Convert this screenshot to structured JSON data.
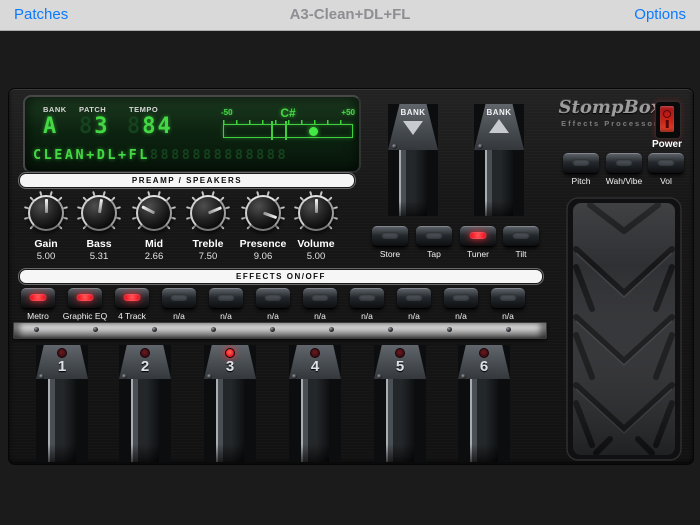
{
  "nav": {
    "left_button": "Patches",
    "title": "A3-Clean+DL+FL",
    "right_button": "Options"
  },
  "brand": {
    "name": "StompBox",
    "tagline": "Effects Processor"
  },
  "power": {
    "label": "Power"
  },
  "lcd": {
    "bank": {
      "label": "BANK",
      "value": "A"
    },
    "patch": {
      "label": "PATCH",
      "ghost": "8",
      "value": "3"
    },
    "tempo": {
      "label": "TEMPO",
      "ghost": "8",
      "value": "84"
    },
    "message": {
      "value": "CLEAN+DL+FL",
      "ghost": "8888888888888"
    },
    "tuner": {
      "min": "-50",
      "note": "C#",
      "max": "+50",
      "dot_percent": 69,
      "bracket_percent": 42
    }
  },
  "sections": {
    "preamp": "PREAMP / SPEAKERS",
    "effects": "EFFECTS ON/OFF"
  },
  "knobs": [
    {
      "label": "Gain",
      "value": "5.00"
    },
    {
      "label": "Bass",
      "value": "5.31"
    },
    {
      "label": "Mid",
      "value": "2.66"
    },
    {
      "label": "Treble",
      "value": "7.50"
    },
    {
      "label": "Presence",
      "value": "9.06"
    },
    {
      "label": "Volume",
      "value": "5.00"
    }
  ],
  "bank_pedals": [
    {
      "label": "BANK",
      "direction": "down"
    },
    {
      "label": "BANK",
      "direction": "up"
    }
  ],
  "utility_buttons": [
    {
      "label": "Store",
      "lit": false
    },
    {
      "label": "Tap",
      "lit": false
    },
    {
      "label": "Tuner",
      "lit": true
    },
    {
      "label": "Tilt",
      "lit": false
    }
  ],
  "toe_buttons": [
    {
      "label": "Pitch",
      "lit": false
    },
    {
      "label": "Wah/Vibe",
      "lit": false
    },
    {
      "label": "Vol",
      "lit": false
    }
  ],
  "effect_buttons": [
    {
      "label": "Metro",
      "lit": true
    },
    {
      "label": "Graphic EQ",
      "lit": true
    },
    {
      "label": "4 Track",
      "lit": true
    },
    {
      "label": "n/a",
      "lit": false
    },
    {
      "label": "n/a",
      "lit": false
    },
    {
      "label": "n/a",
      "lit": false
    },
    {
      "label": "n/a",
      "lit": false
    },
    {
      "label": "n/a",
      "lit": false
    },
    {
      "label": "n/a",
      "lit": false
    },
    {
      "label": "n/a",
      "lit": false
    },
    {
      "label": "n/a",
      "lit": false
    }
  ],
  "footswitches": [
    {
      "number": "1",
      "lit": false
    },
    {
      "number": "2",
      "lit": false
    },
    {
      "number": "3",
      "lit": true
    },
    {
      "number": "4",
      "lit": false
    },
    {
      "number": "5",
      "lit": false
    },
    {
      "number": "6",
      "lit": false
    }
  ],
  "colors": {
    "lcd_green": "#44d944",
    "lcd_dim_green": "#14421c",
    "led_red": "#e81420",
    "nav_link": "#0a7aff"
  }
}
